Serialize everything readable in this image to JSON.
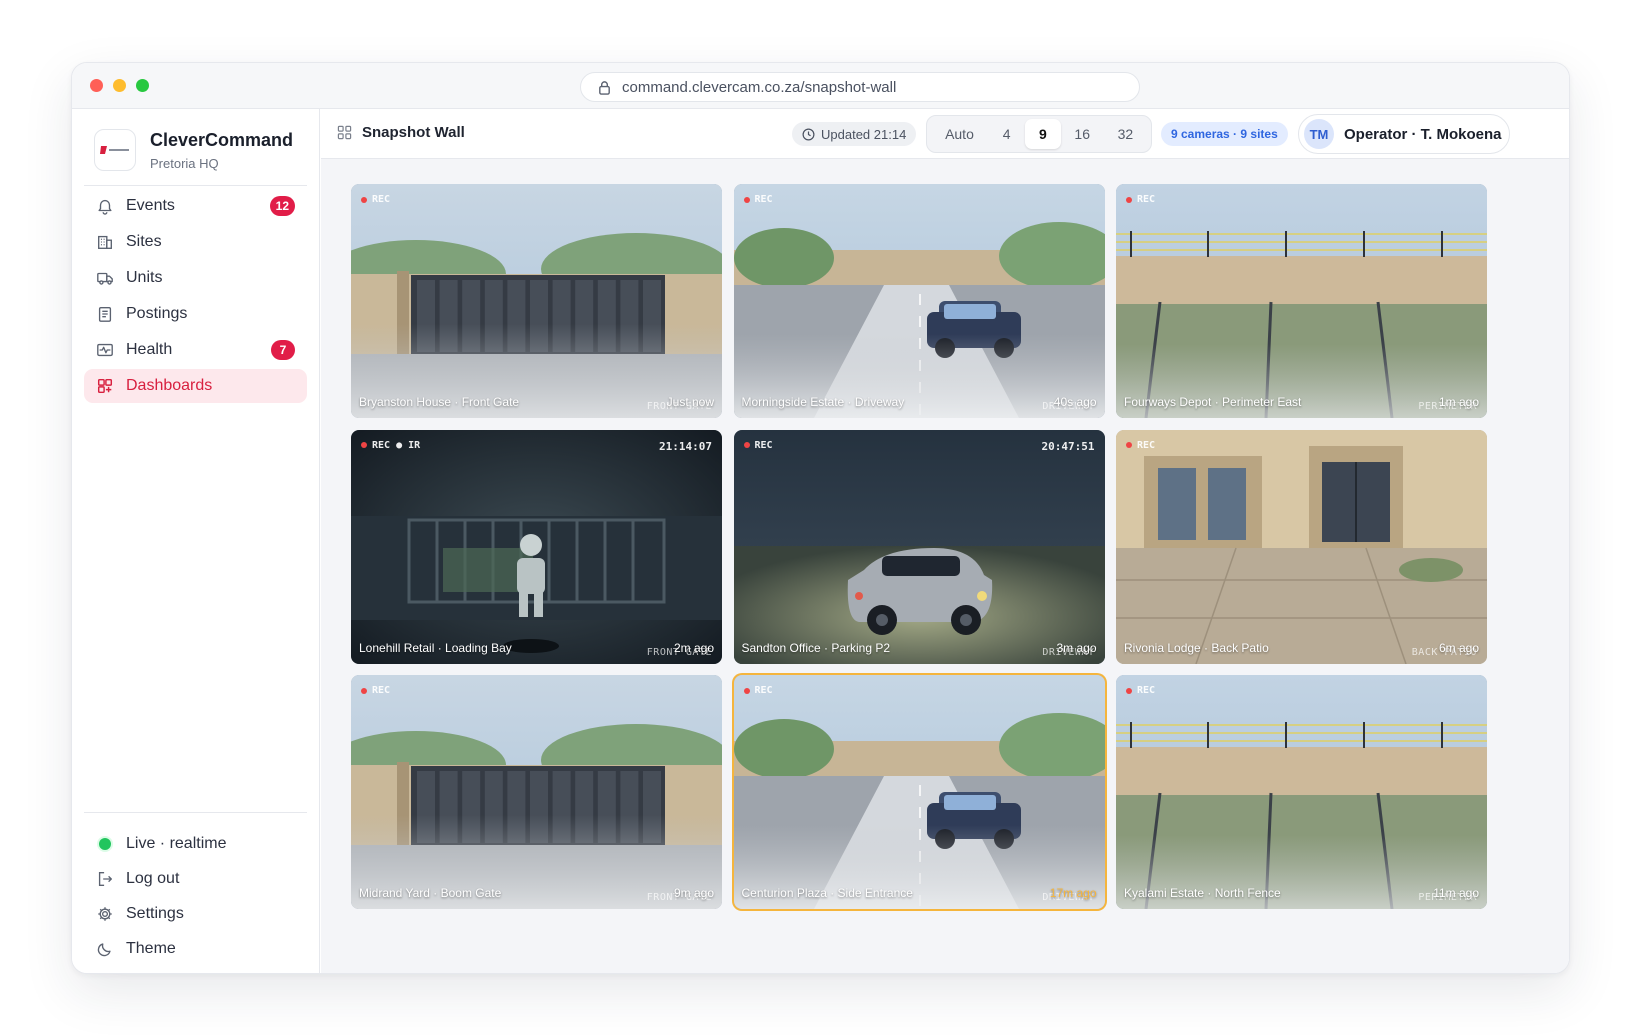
{
  "browser": {
    "url": "command.clevercam.co.za/snapshot-wall"
  },
  "brand": {
    "name": "CleverCommand",
    "subtitle": "Pretoria HQ"
  },
  "nav": [
    {
      "label": "Events",
      "icon": "bell-icon",
      "badge": "12"
    },
    {
      "label": "Sites",
      "icon": "building-icon"
    },
    {
      "label": "Units",
      "icon": "truck-icon"
    },
    {
      "label": "Postings",
      "icon": "clipboard-icon"
    },
    {
      "label": "Health",
      "icon": "heartbeat-icon",
      "badge": "7"
    },
    {
      "label": "Dashboards",
      "icon": "dashboard-icon",
      "active": true
    }
  ],
  "footer": {
    "live": "Live · realtime",
    "logout": "Log out",
    "settings": "Settings",
    "theme": "Theme"
  },
  "header": {
    "title": "Snapshot Wall",
    "updated": "Updated 21:14",
    "layout_options": [
      "Auto",
      "4",
      "9",
      "16",
      "32"
    ],
    "layout_selected": "9",
    "count": "9 cameras · 9 sites",
    "operator_initials": "TM",
    "operator_name": "Operator · T. Mokoena"
  },
  "colors": {
    "accent": "#e11d48",
    "active_bg": "#fde8ec",
    "info": "#2f66e0",
    "warn": "#f5b53d"
  },
  "cameras": [
    {
      "name": "Bryanston House · Front Gate",
      "age": "Just now",
      "zone": "FRONT GATE",
      "rec": "REC",
      "scene": "gate"
    },
    {
      "name": "Morningside Estate · Driveway",
      "age": "40s ago",
      "zone": "DRIVEWAY",
      "rec": "REC",
      "scene": "driveway"
    },
    {
      "name": "Fourways Depot · Perimeter East",
      "age": "1m ago",
      "zone": "PERIMETER",
      "rec": "REC",
      "scene": "perimeter"
    },
    {
      "name": "Lonehill Retail · Loading Bay",
      "age": "2m ago",
      "zone": "FRONT GATE",
      "rec": "REC ● IR",
      "time": "21:14:07",
      "scene": "night-gate"
    },
    {
      "name": "Sandton Office · Parking P2",
      "age": "3m ago",
      "zone": "DRIVEWAY",
      "rec": "REC",
      "time": "20:47:51",
      "scene": "night-parking"
    },
    {
      "name": "Rivonia Lodge · Back Patio",
      "age": "6m ago",
      "zone": "BACK PATIO",
      "rec": "REC",
      "scene": "patio"
    },
    {
      "name": "Midrand Yard · Boom Gate",
      "age": "9m ago",
      "zone": "FRONT GATE",
      "rec": "REC",
      "scene": "gate"
    },
    {
      "name": "Centurion Plaza · Side Entrance",
      "age": "17m ago",
      "zone": "DRIVEWAY",
      "rec": "REC",
      "scene": "driveway",
      "stale": true
    },
    {
      "name": "Kyalami Estate · North Fence",
      "age": "11m ago",
      "zone": "PERIMETER",
      "rec": "REC",
      "scene": "perimeter"
    }
  ]
}
